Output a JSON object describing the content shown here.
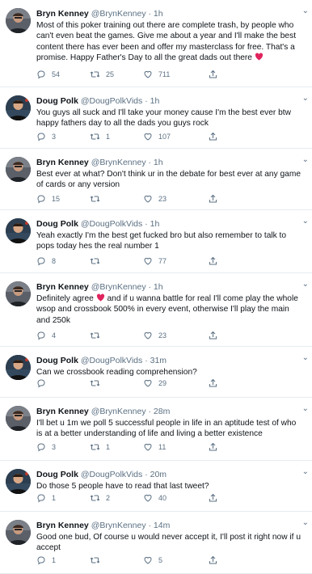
{
  "tweets": [
    {
      "avatar": "bryn",
      "name": "Bryn Kenney",
      "handle": "@BrynKenney",
      "time": "1h",
      "text": "Most of this poker training out there are complete trash, by people who can't even beat the games.  Give me about a year and I'll make the best content there has ever been and offer my masterclass for free.  That's a promise.  Happy Father's Day to all the great dads out there",
      "heart_emoji": true,
      "replies": "54",
      "retweets": "25",
      "likes": "711"
    },
    {
      "avatar": "doug",
      "name": "Doug Polk",
      "handle": "@DougPolkVids",
      "time": "1h",
      "text": "You guys all suck and I'll take your money cause I'm the best ever btw happy fathers day to all the dads you guys rock",
      "replies": "3",
      "retweets": "1",
      "likes": "107"
    },
    {
      "avatar": "bryn",
      "name": "Bryn Kenney",
      "handle": "@BrynKenney",
      "time": "1h",
      "text": "Best ever at what?  Don't think ur in the debate for best ever at any game of cards or any version",
      "replies": "15",
      "retweets": "",
      "likes": "23"
    },
    {
      "avatar": "doug",
      "name": "Doug Polk",
      "handle": "@DougPolkVids",
      "time": "1h",
      "text": "Yeah exactly I'm the best get fucked bro but also remember to talk to pops today hes the real number 1",
      "replies": "8",
      "retweets": "",
      "likes": "77"
    },
    {
      "avatar": "bryn",
      "name": "Bryn Kenney",
      "handle": "@BrynKenney",
      "time": "1h",
      "text_before": "Definitely agree",
      "text": "and if u wanna battle for real I'll come play the whole wsop and crossbook 500% in every event, otherwise I'll play the main and 250k",
      "heart_emoji": true,
      "replies": "4",
      "retweets": "",
      "likes": "23"
    },
    {
      "avatar": "doug",
      "name": "Doug Polk",
      "handle": "@DougPolkVids",
      "time": "31m",
      "text": "Can we crossbook reading comprehension?",
      "replies": "",
      "retweets": "",
      "likes": "29"
    },
    {
      "avatar": "bryn",
      "name": "Bryn Kenney",
      "handle": "@BrynKenney",
      "time": "28m",
      "text": "I'll bet u 1m we poll 5 successful people in life in an aptitude test of who is at a better understanding of life and living a better existence",
      "replies": "3",
      "retweets": "1",
      "likes": "11"
    },
    {
      "avatar": "doug",
      "name": "Doug Polk",
      "handle": "@DougPolkVids",
      "time": "20m",
      "text": "Do those 5 people have to read that last tweet?",
      "replies": "1",
      "retweets": "2",
      "likes": "40"
    },
    {
      "avatar": "bryn",
      "name": "Bryn Kenney",
      "handle": "@BrynKenney",
      "time": "14m",
      "text": "Good one bud, Of course u would never accept it, I'll post it right now if u accept",
      "replies": "1",
      "retweets": "",
      "likes": "5"
    }
  ],
  "separator": "·",
  "colors": {
    "text": "#0f1419",
    "muted": "#5b7083",
    "heart": "#e0245e",
    "divider": "#e6ecf0"
  },
  "icons": {
    "reply": "reply-icon",
    "retweet": "retweet-icon",
    "like": "like-icon",
    "share": "share-icon",
    "more": "chevron-down-icon"
  }
}
